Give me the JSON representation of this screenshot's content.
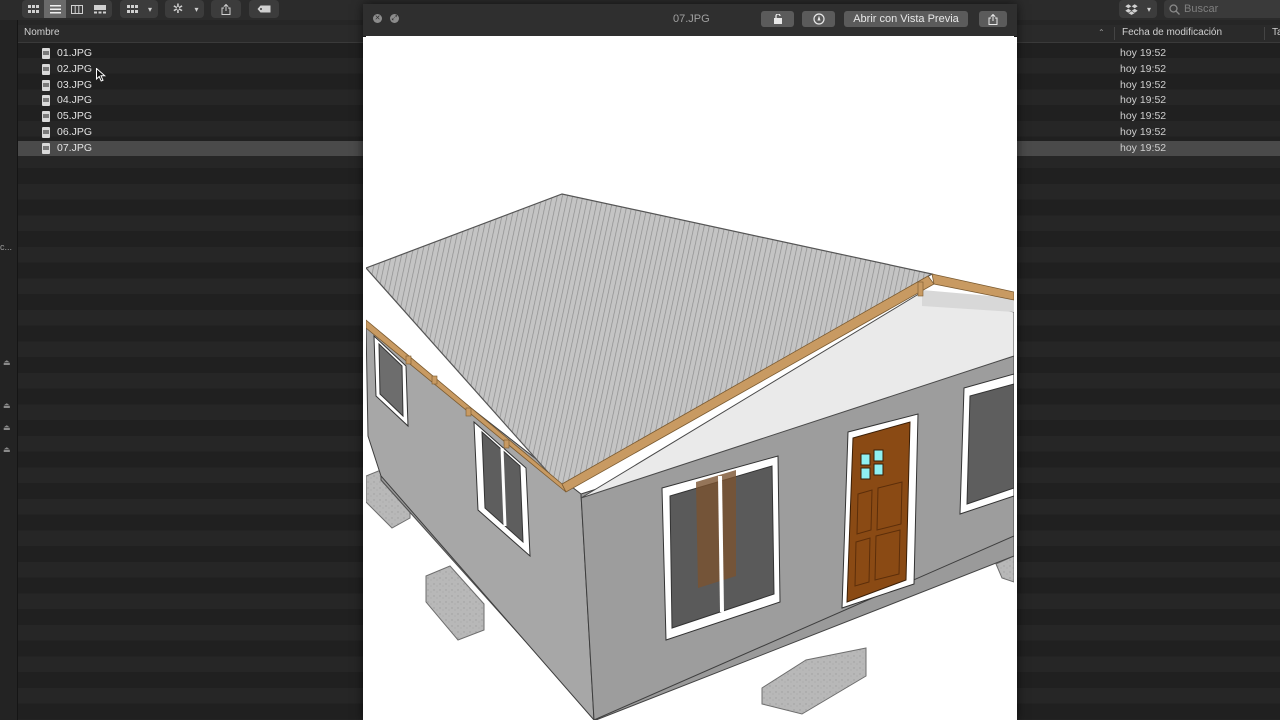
{
  "toolbar": {
    "view_icons": [
      "icon-view-icon",
      "list-view-icon",
      "column-view-icon",
      "gallery-view-icon"
    ],
    "search_placeholder": "Buscar"
  },
  "list": {
    "columns": {
      "name": "Nombre",
      "date": "Fecha de modificación",
      "extra": "Ta"
    },
    "files": [
      {
        "name": "01.JPG",
        "date": "hoy 19:52",
        "selected": false
      },
      {
        "name": "02.JPG",
        "date": "hoy 19:52",
        "selected": false
      },
      {
        "name": "03.JPG",
        "date": "hoy 19:52",
        "selected": false
      },
      {
        "name": "04.JPG",
        "date": "hoy 19:52",
        "selected": false
      },
      {
        "name": "05.JPG",
        "date": "hoy 19:52",
        "selected": false
      },
      {
        "name": "06.JPG",
        "date": "hoy 19:52",
        "selected": false
      },
      {
        "name": "07.JPG",
        "date": "hoy 19:52",
        "selected": true
      }
    ]
  },
  "sidebar": {
    "truncated_label": "c..."
  },
  "quicklook": {
    "title": "07.JPG",
    "open_with_label": "Abrir con Vista Previa",
    "image_description_icon": "house-3d-model"
  },
  "colors": {
    "background": "#1e1e1e",
    "roof": "#b8b8b8",
    "wall": "#9c9c9c",
    "door": "#8a4a14",
    "trim": "#c89a62"
  }
}
